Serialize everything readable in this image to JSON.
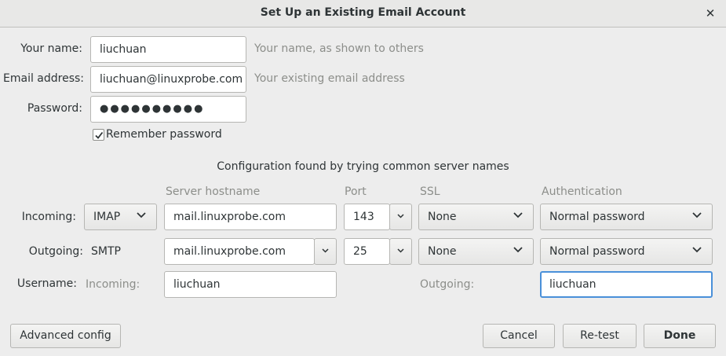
{
  "window": {
    "title": "Set Up an Existing Email Account",
    "close_glyph": "✕"
  },
  "identity": {
    "name_label": "Your name:",
    "name_value": "liuchuan",
    "name_hint": "Your name, as shown to others",
    "email_label": "Email address:",
    "email_value": "liuchuan@linuxprobe.com",
    "email_hint": "Your existing email address",
    "password_label": "Password:",
    "password_value": "●●●●●●●●●●",
    "remember_label": "Remember password",
    "remember_checked": true
  },
  "config_status": "Configuration found by trying common server names",
  "columns": {
    "hostname": "Server hostname",
    "port": "Port",
    "ssl": "SSL",
    "auth": "Authentication"
  },
  "incoming": {
    "label": "Incoming:",
    "protocol": "IMAP",
    "hostname": "mail.linuxprobe.com",
    "port": "143",
    "ssl": "None",
    "auth": "Normal password"
  },
  "outgoing": {
    "label": "Outgoing:",
    "protocol": "SMTP",
    "hostname": "mail.linuxprobe.com",
    "port": "25",
    "ssl": "None",
    "auth": "Normal password"
  },
  "username": {
    "label": "Username:",
    "incoming_label": "Incoming:",
    "incoming_value": "liuchuan",
    "outgoing_label": "Outgoing:",
    "outgoing_value": "liuchuan"
  },
  "buttons": {
    "advanced": "Advanced config",
    "cancel": "Cancel",
    "retest": "Re-test",
    "done": "Done"
  },
  "colors": {
    "focus_accent": "#4a90d9",
    "hint_text": "#8c8e8a",
    "background": "#ededed"
  }
}
